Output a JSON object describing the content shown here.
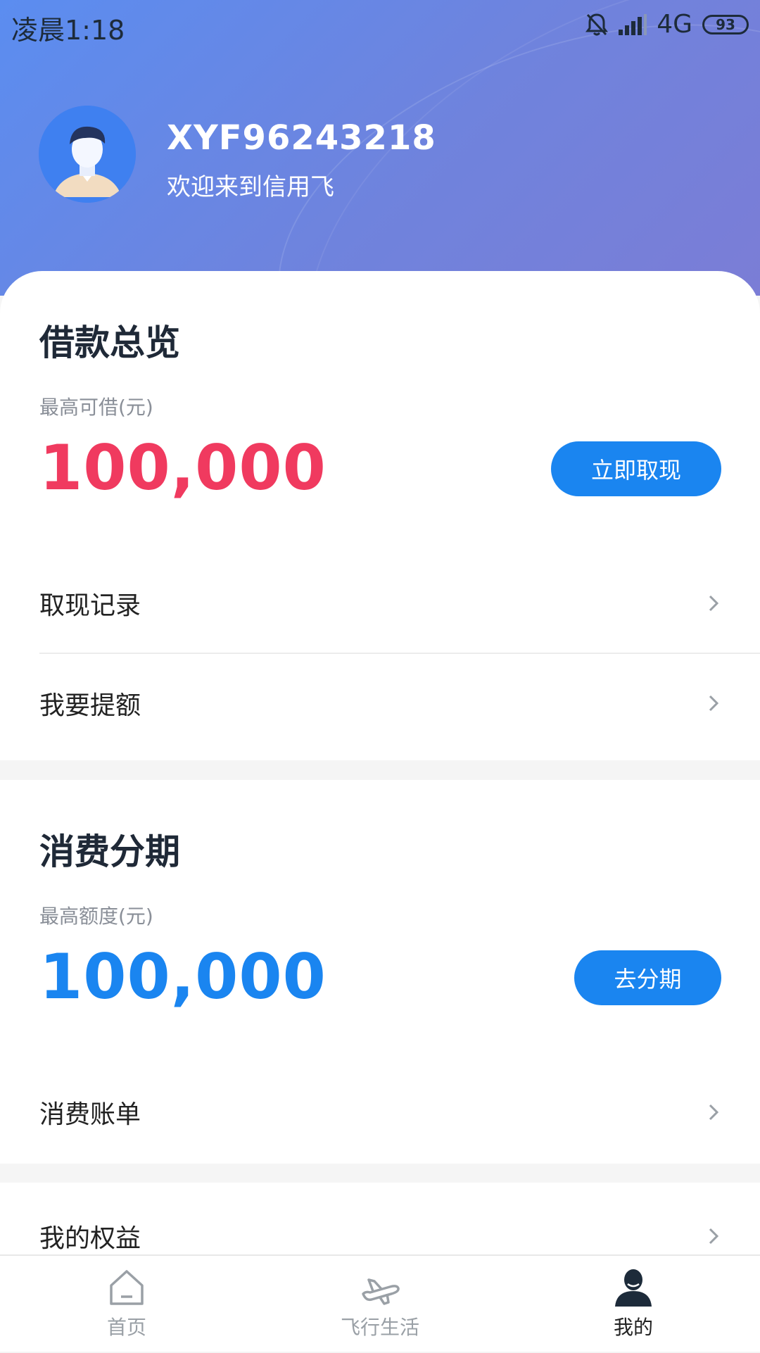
{
  "status_bar": {
    "time": "凌晨1:18",
    "network": "4G",
    "battery": "93"
  },
  "profile": {
    "username": "XYF96243218",
    "welcome": "欢迎来到信用飞"
  },
  "loan_overview": {
    "title": "借款总览",
    "limit_label": "最高可借(元)",
    "amount": "100,000",
    "button": "立即取现",
    "rows": [
      "取现记录",
      "我要提额"
    ]
  },
  "installment": {
    "title": "消费分期",
    "limit_label": "最高额度(元)",
    "amount": "100,000",
    "button": "去分期",
    "rows": [
      "消费账单"
    ]
  },
  "benefits": {
    "label": "我的权益"
  },
  "nav": {
    "items": [
      {
        "label": "首页",
        "icon": "home-icon"
      },
      {
        "label": "飞行生活",
        "icon": "plane-icon"
      },
      {
        "label": "我的",
        "icon": "user-icon"
      }
    ],
    "active": "我的"
  },
  "colors": {
    "loan_amount": "#f03a5f",
    "installment_amount": "#1a85f0",
    "button": "#1a85f0"
  }
}
